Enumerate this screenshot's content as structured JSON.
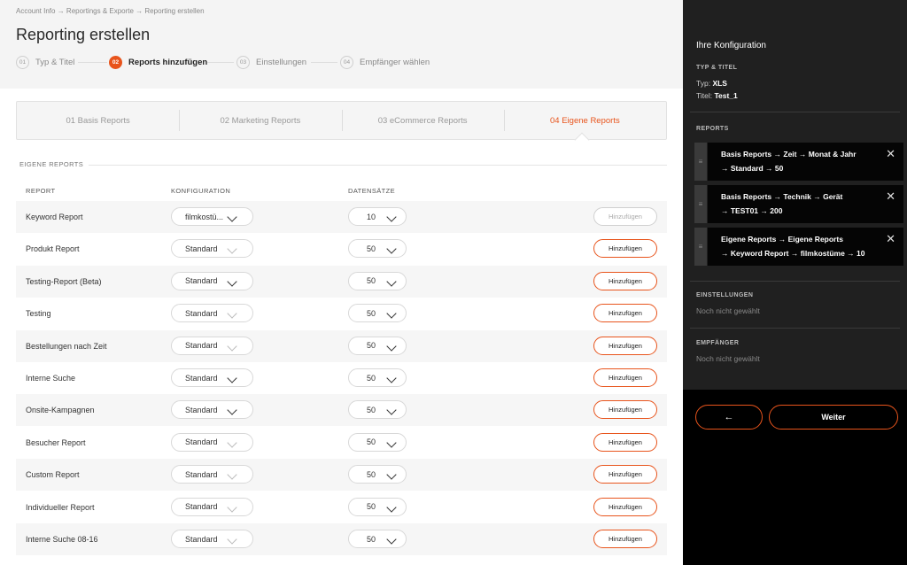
{
  "breadcrumb": "Account Info → Reportings & Exporte → Reporting erstellen",
  "page_title": "Reporting erstellen",
  "steps": [
    {
      "num": "01",
      "label": "Typ & Titel",
      "active": false
    },
    {
      "num": "02",
      "label": "Reports hinzufügen",
      "active": true
    },
    {
      "num": "03",
      "label": "Einstellungen",
      "active": false
    },
    {
      "num": "04",
      "label": "Empfänger wählen",
      "active": false
    }
  ],
  "tabs": [
    {
      "label": "01 Basis Reports",
      "active": false
    },
    {
      "label": "02 Marketing Reports",
      "active": false
    },
    {
      "label": "03 eCommerce Reports",
      "active": false
    },
    {
      "label": "04 Eigene Reports",
      "active": true
    }
  ],
  "section_title": "EIGENE REPORTS",
  "columns": {
    "report": "REPORT",
    "config": "KONFIGURATION",
    "records": "DATENSÄTZE"
  },
  "rows": [
    {
      "name": "Keyword Report",
      "config": "filmkostü...",
      "records": "10",
      "button": "Hinzufügen",
      "disabled": true,
      "config_chev_light": false,
      "records_chev_light": false
    },
    {
      "name": "Produkt Report",
      "config": "Standard",
      "records": "50",
      "button": "Hinzufügen",
      "disabled": false,
      "config_chev_light": true,
      "records_chev_light": false
    },
    {
      "name": "Testing-Report (Beta)",
      "config": "Standard",
      "records": "50",
      "button": "Hinzufügen",
      "disabled": false,
      "config_chev_light": false,
      "records_chev_light": false
    },
    {
      "name": "Testing",
      "config": "Standard",
      "records": "50",
      "button": "Hinzufügen",
      "disabled": false,
      "config_chev_light": true,
      "records_chev_light": false
    },
    {
      "name": "Bestellungen nach Zeit",
      "config": "Standard",
      "records": "50",
      "button": "Hinzufügen",
      "disabled": false,
      "config_chev_light": true,
      "records_chev_light": false
    },
    {
      "name": "Interne Suche",
      "config": "Standard",
      "records": "50",
      "button": "Hinzufügen",
      "disabled": false,
      "config_chev_light": false,
      "records_chev_light": false
    },
    {
      "name": "Onsite-Kampagnen",
      "config": "Standard",
      "records": "50",
      "button": "Hinzufügen",
      "disabled": false,
      "config_chev_light": false,
      "records_chev_light": false
    },
    {
      "name": "Besucher Report",
      "config": "Standard",
      "records": "50",
      "button": "Hinzufügen",
      "disabled": false,
      "config_chev_light": true,
      "records_chev_light": false
    },
    {
      "name": "Custom Report",
      "config": "Standard",
      "records": "50",
      "button": "Hinzufügen",
      "disabled": false,
      "config_chev_light": true,
      "records_chev_light": false
    },
    {
      "name": "Individueller Report",
      "config": "Standard",
      "records": "50",
      "button": "Hinzufügen",
      "disabled": false,
      "config_chev_light": true,
      "records_chev_light": false
    },
    {
      "name": "Interne Suche 08-16",
      "config": "Standard",
      "records": "50",
      "button": "Hinzufügen",
      "disabled": false,
      "config_chev_light": true,
      "records_chev_light": false
    }
  ],
  "panel": {
    "title": "Ihre Konfiguration",
    "type_title_label": "TYP & TITEL",
    "type_prefix": "Typ:",
    "type_value": "XLS",
    "title_prefix": "Titel:",
    "title_value": "Test_1",
    "reports_label": "REPORTS",
    "reports": [
      {
        "line1": "Basis Reports  → Zeit  → Monat & Jahr",
        "line2": "→ Standard  → 50"
      },
      {
        "line1": "Basis Reports  → Technik  → Gerät",
        "line2": "→ TEST01  → 200"
      },
      {
        "line1": "Eigene Reports  → Eigene Reports",
        "line2": "→ Keyword Report  → filmkostüme  → 10"
      }
    ],
    "settings_label": "EINSTELLUNGEN",
    "settings_value": "Noch nicht gewählt",
    "recipients_label": "EMPFÄNGER",
    "recipients_value": "Noch nicht gewählt",
    "back_label": "←",
    "next_label": "Weiter"
  },
  "colors": {
    "accent": "#e8541c",
    "panel_bg": "#202020"
  }
}
